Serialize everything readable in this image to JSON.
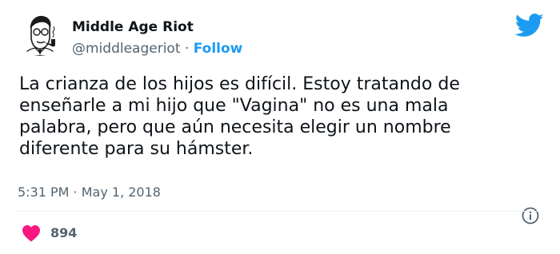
{
  "author": {
    "display_name": "Middle Age Riot",
    "handle": "@middleageriot",
    "separator": " · ",
    "follow_label": "Follow"
  },
  "tweet": {
    "text": "La crianza de los hijos es difícil. Estoy tratando de\nenseñarle a mi hijo que \"Vagina\" no es una mala\npalabra, pero que aún necesita elegir un nombre\ndiferente para su hámster.",
    "timestamp": "5:31 PM · May 1, 2018"
  },
  "engagement": {
    "likes": "894"
  },
  "icons": {
    "logo": "twitter-bird-icon",
    "info": "info-icon",
    "like": "heart-icon",
    "avatar": "avatar-illustration"
  },
  "colors": {
    "accent": "#1d9bf0",
    "heart": "#f91880",
    "text": "#0f1419",
    "muted": "#536471"
  }
}
